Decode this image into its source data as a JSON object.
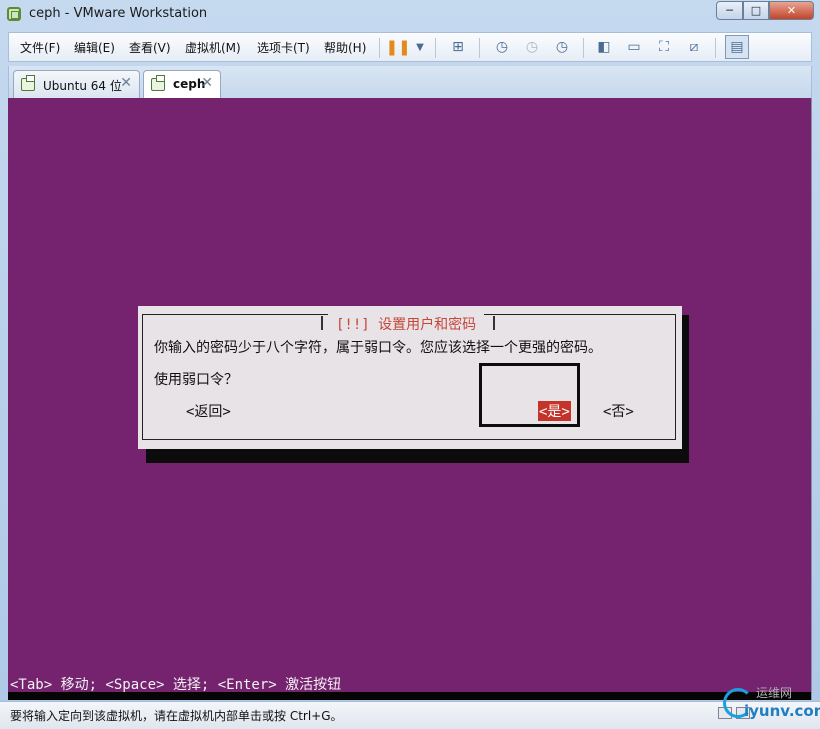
{
  "window": {
    "title": "ceph - VMware Workstation",
    "controls": {
      "minimize": "─",
      "maximize": "□",
      "close": "✕"
    }
  },
  "menu": {
    "items": [
      "文件(F)",
      "编辑(E)",
      "查看(V)",
      "虚拟机(M)",
      "选项卡(T)",
      "帮助(H)"
    ]
  },
  "toolbar": {
    "icons": [
      "pause-icon",
      "dropdown-arrow-icon",
      "send-ctrl-alt-del-icon",
      "snapshot-take-icon",
      "snapshot-revert-icon",
      "snapshot-manager-icon",
      "show-library-icon",
      "show-thumbnails-icon",
      "full-screen-icon",
      "unity-icon",
      "console-view-icon"
    ]
  },
  "tabs": [
    {
      "label": "Ubuntu 64 位",
      "close": "✕",
      "active": false
    },
    {
      "label": "ceph",
      "close": "✕",
      "active": true
    }
  ],
  "vm": {
    "background_color": "#75226f",
    "dialog": {
      "title": "[!!] 设置用户和密码",
      "message": "你输入的密码少于八个字符，属于弱口令。您应该选择一个更强的密码。",
      "question": "使用弱口令？",
      "buttons": {
        "back": "<返回>",
        "yes": "<是>",
        "no": "<否>"
      },
      "selected_button": "yes",
      "selected_color": "#c4342a"
    },
    "hint": "<Tab> 移动; <Space> 选择; <Enter> 激活按钮"
  },
  "statusbar": {
    "text": "要将输入定向到该虚拟机，请在虚拟机内部单击或按 Ctrl+G。"
  },
  "watermark": {
    "cn": "运维网",
    "en": "iyunv.com"
  }
}
